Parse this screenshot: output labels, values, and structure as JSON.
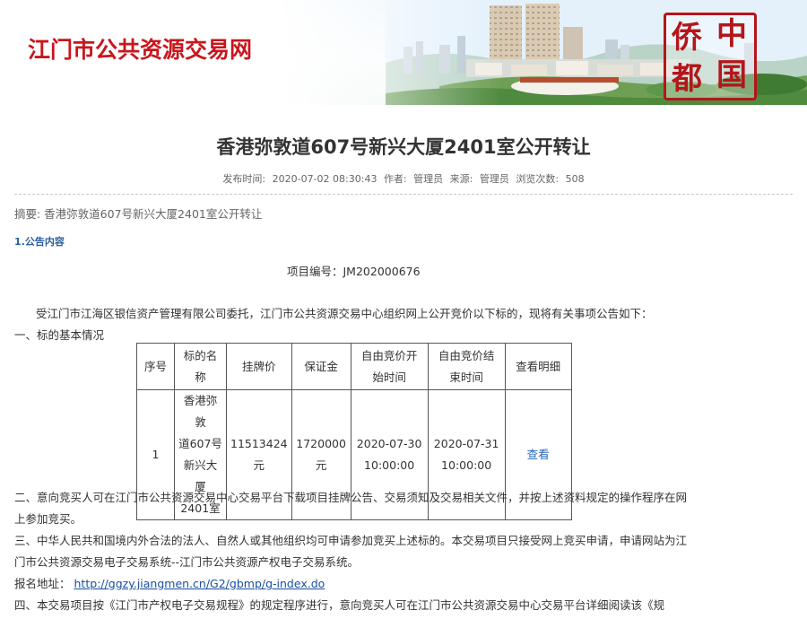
{
  "site": {
    "title": "江门市公共资源交易网",
    "logo_chars": [
      "侨",
      "中",
      "都",
      "国"
    ],
    "brand_color": "#c9161d"
  },
  "article": {
    "title": "香港弥敦道607号新兴大厦2401室公开转让",
    "meta": {
      "publish_label": "发布时间:",
      "publish_time": "2020-07-02 08:30:43",
      "author_label": "作者:",
      "author": "管理员",
      "source_label": "来源:",
      "source": "管理员",
      "views_label": "浏览次数:",
      "views": "508"
    },
    "summary": "摘要: 香港弥敦道607号新兴大厦2401室公开转让",
    "section": "1.公告内容",
    "project_no": "项目编号：JM202000676",
    "intro": "受江门市江海区银信资产管理有限公司委托，江门市公共资源交易中心组织网上公开竞价以下标的，现将有关事项公告如下：",
    "part1": "一、标的基本情况",
    "part2_line1": "二、意向竞买人可在江门市公共资源交易中心交易平台下载项目挂牌公告、交易须知及交易相关文件，并按上述资料规定的操作程序在网",
    "part2_line2": "上参加竞买。",
    "part3_line1": "三、中华人民共和国境内外合法的法人、自然人或其他组织均可申请参加竞买上述标的。本交易项目只接受网上竞买申请，申请网站为江",
    "part3_line2": "门市公共资源交易电子交易系统--江门市公共资源产权电子交易系统。",
    "signup_label": "报名地址：",
    "signup_link": "http://ggzy.jiangmen.cn/G2/gbmp/g-index.do",
    "part4_line1": "四、本交易项目按《江门市产权电子交易规程》的规定程序进行，意向竞买人可在江门市公共资源交易中心交易平台详细阅读该《规"
  },
  "table": {
    "headers": [
      "序号",
      "标的名称",
      "挂牌价",
      "保证金",
      "自由竞价开\n始时间",
      "自由竞价结\n束时间",
      "查看明细"
    ],
    "rows": [
      {
        "no": "1",
        "name_lines": [
          "香港弥敦",
          "道607号",
          "新兴大厦",
          "2401室"
        ],
        "price_lines": [
          "11513424",
          "元"
        ],
        "deposit_lines": [
          "1720000",
          "元"
        ],
        "start_lines": [
          "2020-07-30",
          "10:00:00"
        ],
        "end_lines": [
          "2020-07-31",
          "10:00:00"
        ],
        "view": "查看"
      }
    ]
  }
}
